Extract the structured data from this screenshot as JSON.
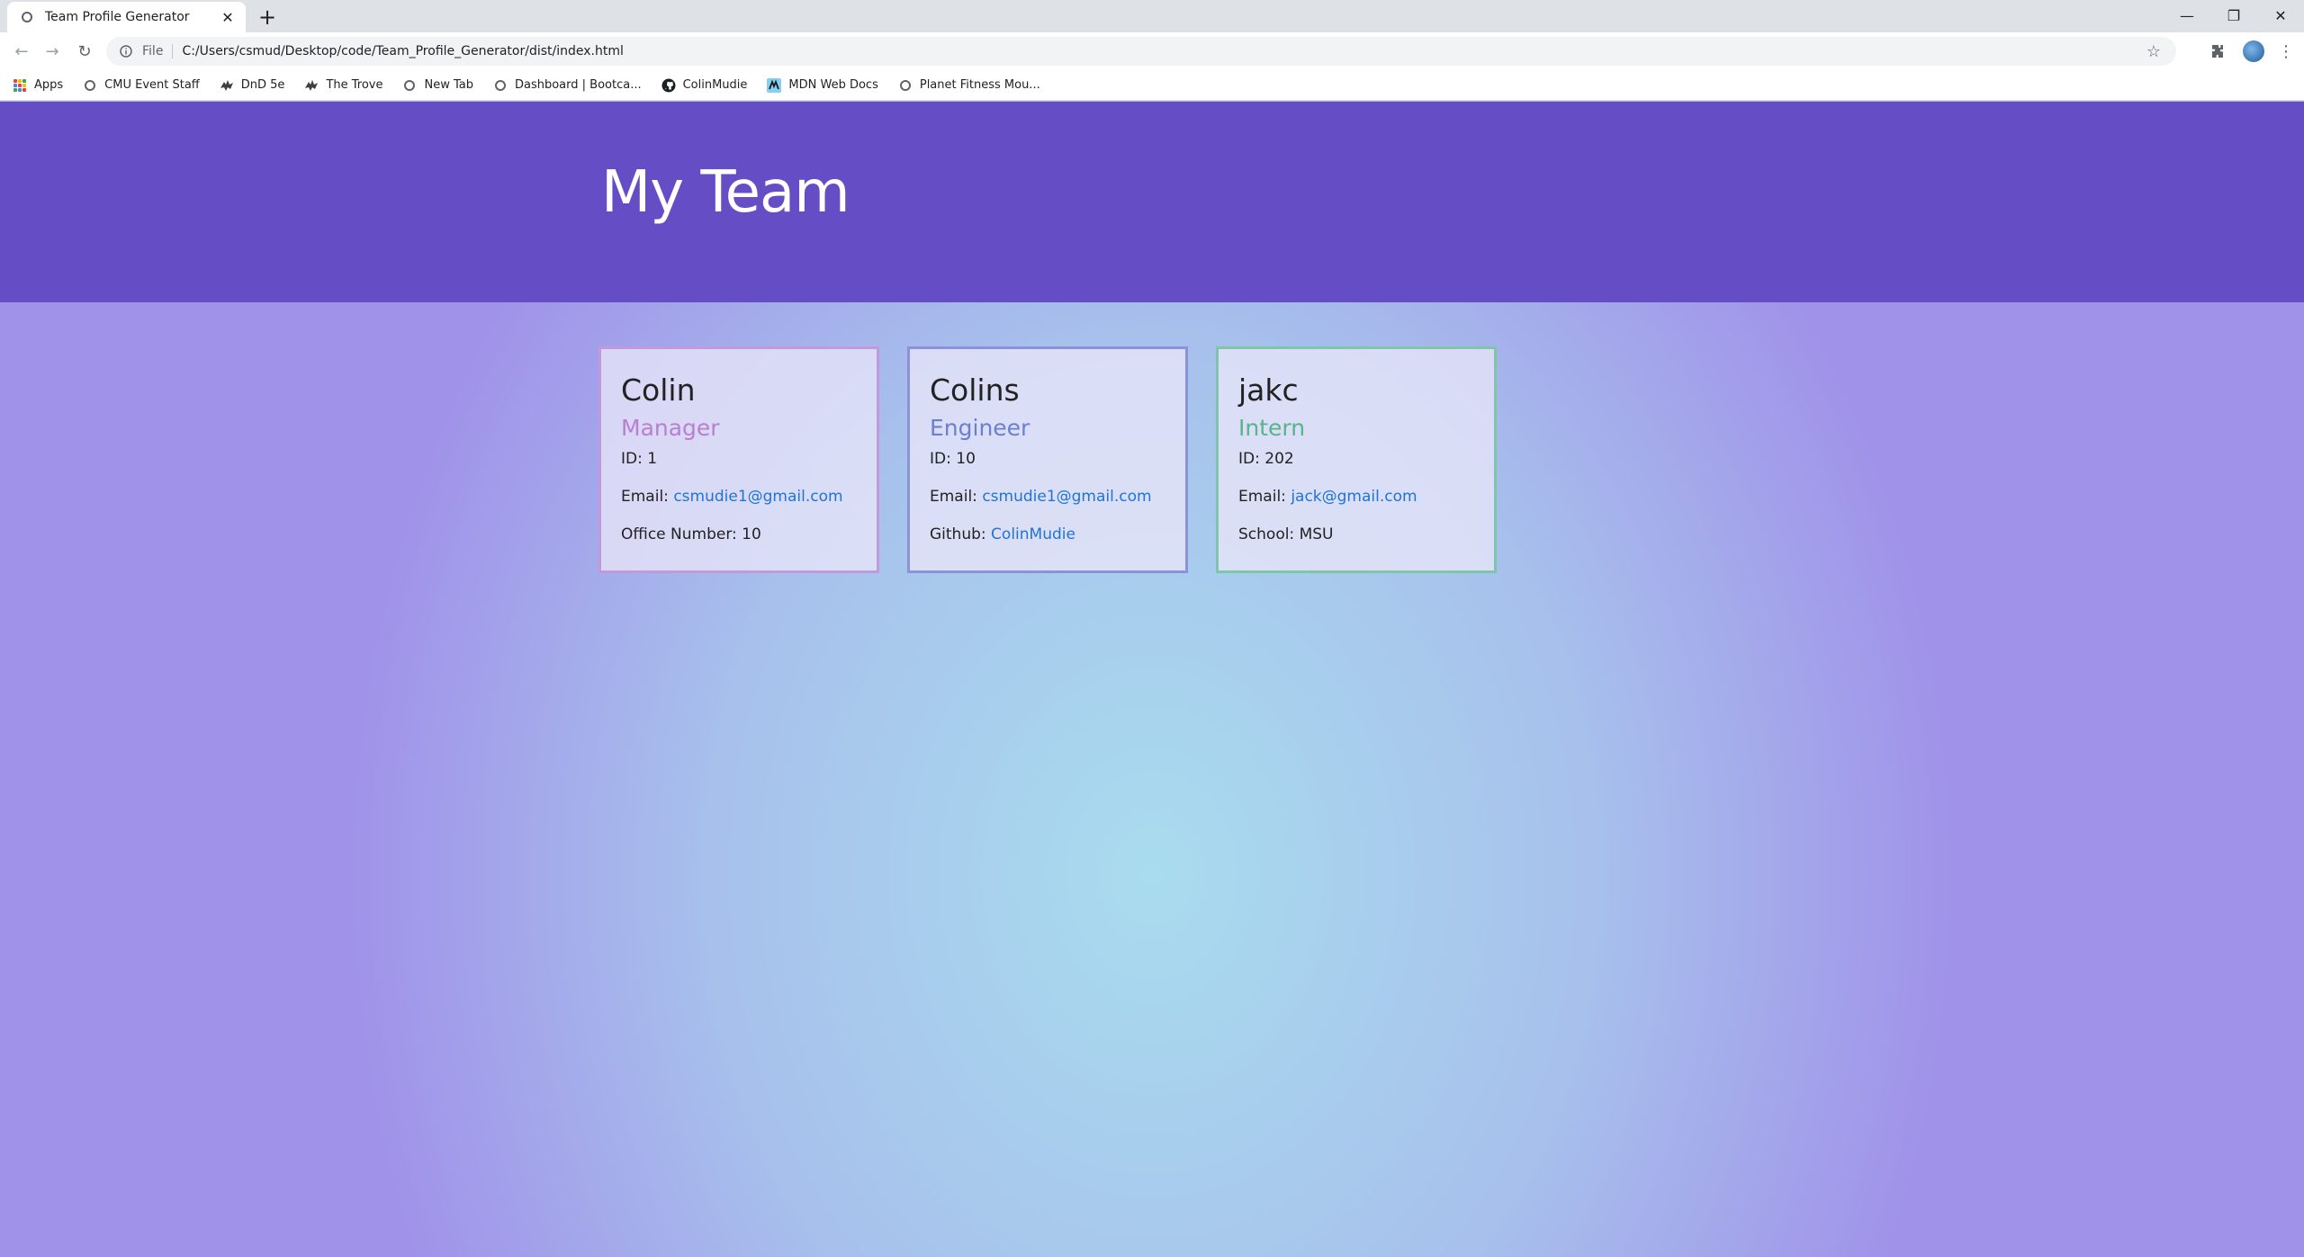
{
  "browser": {
    "tab_title": "Team Profile Generator",
    "new_tab_symbol": "+",
    "address_scheme": "File",
    "url": "C:/Users/csmud/Desktop/code/Team_Profile_Generator/dist/index.html",
    "bookmarks": [
      {
        "label": "Apps",
        "icon": "apps-grid-icon"
      },
      {
        "label": "CMU Event Staff",
        "icon": "globe-icon"
      },
      {
        "label": "DnD 5e",
        "icon": "dragon-icon"
      },
      {
        "label": "The Trove",
        "icon": "dragon-icon"
      },
      {
        "label": "New Tab",
        "icon": "globe-icon"
      },
      {
        "label": "Dashboard | Bootca...",
        "icon": "globe-icon"
      },
      {
        "label": "ColinMudie",
        "icon": "github-icon"
      },
      {
        "label": "MDN Web Docs",
        "icon": "mdn-icon"
      },
      {
        "label": "Planet Fitness Mou...",
        "icon": "globe-icon"
      }
    ]
  },
  "page": {
    "title": "My Team",
    "members": [
      {
        "name": "Colin",
        "role": "Manager",
        "id_label": "ID:",
        "id": "1",
        "email_label": "Email:",
        "email": "csmudie1@gmail.com",
        "extra_label": "Office Number:",
        "extra_value": "10"
      },
      {
        "name": "Colins",
        "role": "Engineer",
        "id_label": "ID:",
        "id": "10",
        "email_label": "Email:",
        "email": "csmudie1@gmail.com",
        "extra_label": "Github:",
        "extra_value": "ColinMudie"
      },
      {
        "name": "jakc",
        "role": "Intern",
        "id_label": "ID:",
        "id": "202",
        "email_label": "Email:",
        "email": "jack@gmail.com",
        "extra_label": "School:",
        "extra_value": "MSU"
      }
    ]
  },
  "colors": {
    "header_bg": "#654ec5",
    "manager_accent": "#b87fd2",
    "engineer_accent": "#6d7fce",
    "intern_accent": "#5ab489",
    "link": "#1f74d6"
  }
}
